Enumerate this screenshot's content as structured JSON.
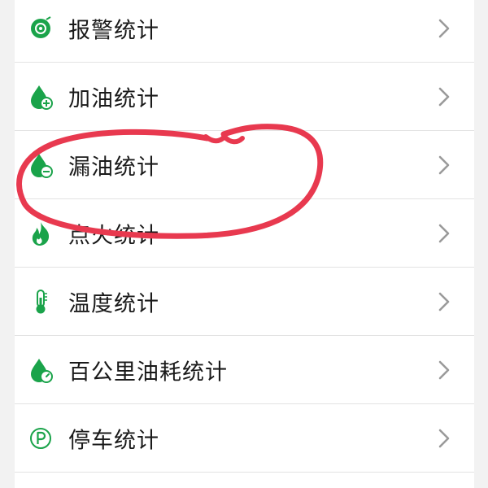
{
  "menu": {
    "items": [
      {
        "label": "报警统计",
        "icon": "alarm-disc-icon"
      },
      {
        "label": "加油统计",
        "icon": "fuel-drop-plus-icon"
      },
      {
        "label": "漏油统计",
        "icon": "fuel-drop-minus-icon"
      },
      {
        "label": "点火统计",
        "icon": "flame-icon"
      },
      {
        "label": "温度统计",
        "icon": "thermometer-icon"
      },
      {
        "label": "百公里油耗统计",
        "icon": "fuel-drop-gauge-icon"
      },
      {
        "label": "停车统计",
        "icon": "parking-icon"
      }
    ]
  },
  "colors": {
    "accent": "#1aa34a",
    "annotation": "#e8394f",
    "chevron": "#9a9a9a",
    "divider": "#e3e3e3",
    "background": "#f2f2f2"
  }
}
